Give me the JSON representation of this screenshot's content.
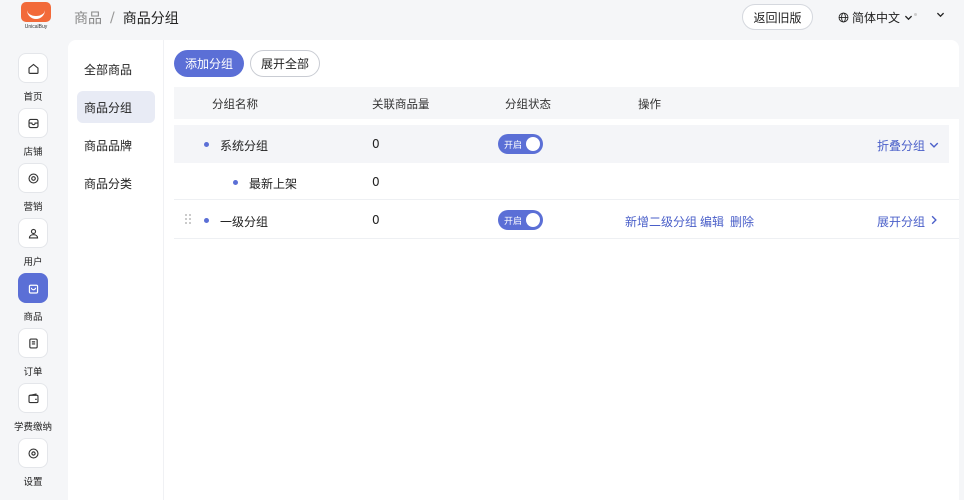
{
  "app": {
    "logo_text": "UnicalBuy"
  },
  "sidebar": {
    "items": [
      {
        "label": "首页",
        "icon": "home-icon"
      },
      {
        "label": "店铺",
        "icon": "store-icon"
      },
      {
        "label": "营销",
        "icon": "target-icon"
      },
      {
        "label": "用户",
        "icon": "user-icon"
      },
      {
        "label": "商品",
        "icon": "shopping-bag-icon",
        "active": true
      },
      {
        "label": "订单",
        "icon": "document-icon"
      },
      {
        "label": "学费缴纳",
        "icon": "wallet-icon"
      },
      {
        "label": "设置",
        "icon": "settings-icon"
      }
    ]
  },
  "header": {
    "breadcrumb": [
      "商品",
      "商品分组"
    ],
    "separator": "/",
    "back_button": "返回旧版",
    "language": "简体中文"
  },
  "subnav": {
    "items": [
      "全部商品",
      "商品分组",
      "商品品牌",
      "商品分类"
    ],
    "active_index": 1
  },
  "toolbar": {
    "add_group": "添加分组",
    "expand_all": "展开全部"
  },
  "table": {
    "columns": [
      "分组名称",
      "关联商品量",
      "分组状态",
      "操作"
    ],
    "rows": [
      {
        "name": "系统分组",
        "count": "0",
        "status": "开启",
        "toggle_on": true,
        "right_action": "折叠分组"
      },
      {
        "name": "最新上架",
        "count": "0",
        "child": true
      },
      {
        "name": "一级分组",
        "count": "0",
        "status": "开启",
        "toggle_on": true,
        "actions": [
          "新增二级分组",
          "编辑",
          "删除"
        ],
        "right_action": "展开分组"
      }
    ]
  },
  "colors": {
    "accent": "#5b6fd6",
    "link": "#4a5fc9",
    "brand": "#f26a3a"
  }
}
